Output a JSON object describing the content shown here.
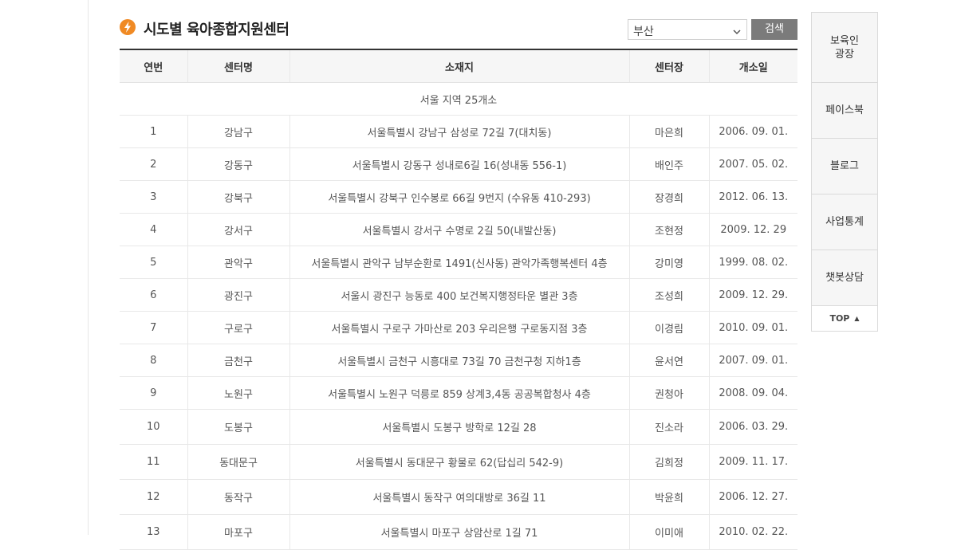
{
  "page": {
    "title": "시도별 육아종합지원센터",
    "region_select": {
      "value": "부산"
    },
    "search_label": "검색"
  },
  "table": {
    "headers": [
      "연번",
      "센터명",
      "소재지",
      "센터장",
      "개소일"
    ],
    "region_caption": "서울 지역 25개소",
    "rows": [
      {
        "no": "1",
        "name": "강남구",
        "addr": "서울특별시 강남구 삼성로 72길 7(대치동)",
        "head": "마은희",
        "date": "2006. 09. 01."
      },
      {
        "no": "2",
        "name": "강동구",
        "addr": "서울특별시 강동구 성내로6길 16(성내동 556-1)",
        "head": "배인주",
        "date": "2007. 05. 02."
      },
      {
        "no": "3",
        "name": "강북구",
        "addr": "서울특별시 강북구 인수봉로 66길 9번지 (수유동 410-293)",
        "head": "장경희",
        "date": "2012. 06. 13."
      },
      {
        "no": "4",
        "name": "강서구",
        "addr": "서울특별시 강서구 수명로 2길 50(내발산동)",
        "head": "조현정",
        "date": "2009. 12. 29"
      },
      {
        "no": "5",
        "name": "관악구",
        "addr": "서울특별시 관악구 남부순환로 1491(신사동) 관악가족행복센터 4층",
        "head": "강미영",
        "date": "1999. 08. 02."
      },
      {
        "no": "6",
        "name": "광진구",
        "addr": "서울시 광진구 능동로 400 보건복지행정타운 별관 3층",
        "head": "조성희",
        "date": "2009. 12. 29."
      },
      {
        "no": "7",
        "name": "구로구",
        "addr": "서울특별시 구로구 가마산로 203 우리은행 구로동지점 3층",
        "head": "이경림",
        "date": "2010. 09. 01."
      },
      {
        "no": "8",
        "name": "금천구",
        "addr": "서울특별시 금천구 시흥대로 73길 70 금천구청 지하1층",
        "head": "윤서연",
        "date": "2007. 09. 01."
      },
      {
        "no": "9",
        "name": "노원구",
        "addr": "서울특별시 노원구 덕릉로 859 상계3,4동 공공복합청사 4층",
        "head": "권청아",
        "date": "2008. 09. 04."
      },
      {
        "no": "10",
        "name": "도봉구",
        "addr": "서울특별시 도봉구 방학로 12길 28",
        "head": "진소라",
        "date": "2006. 03. 29."
      },
      {
        "no": "11",
        "name": "동대문구",
        "addr": "서울특별시 동대문구 황물로 62(답십리 542-9)",
        "head": "김희정",
        "date": "2009. 11. 17."
      },
      {
        "no": "12",
        "name": "동작구",
        "addr": "서울특별시 동작구 여의대방로 36길 11",
        "head": "박윤희",
        "date": "2006. 12. 27."
      },
      {
        "no": "13",
        "name": "마포구",
        "addr": "서울특별시 마포구 상암산로 1길 71",
        "head": "이미애",
        "date": "2010. 02. 22."
      }
    ]
  },
  "sidebar": {
    "items": [
      "보육인\n광장",
      "페이스북",
      "블로그",
      "사업통계",
      "챗봇상담"
    ],
    "top_label": "TOP"
  },
  "colors": {
    "accent": "#f08a24",
    "button": "#7b7b7b",
    "header_rule": "#333333"
  }
}
